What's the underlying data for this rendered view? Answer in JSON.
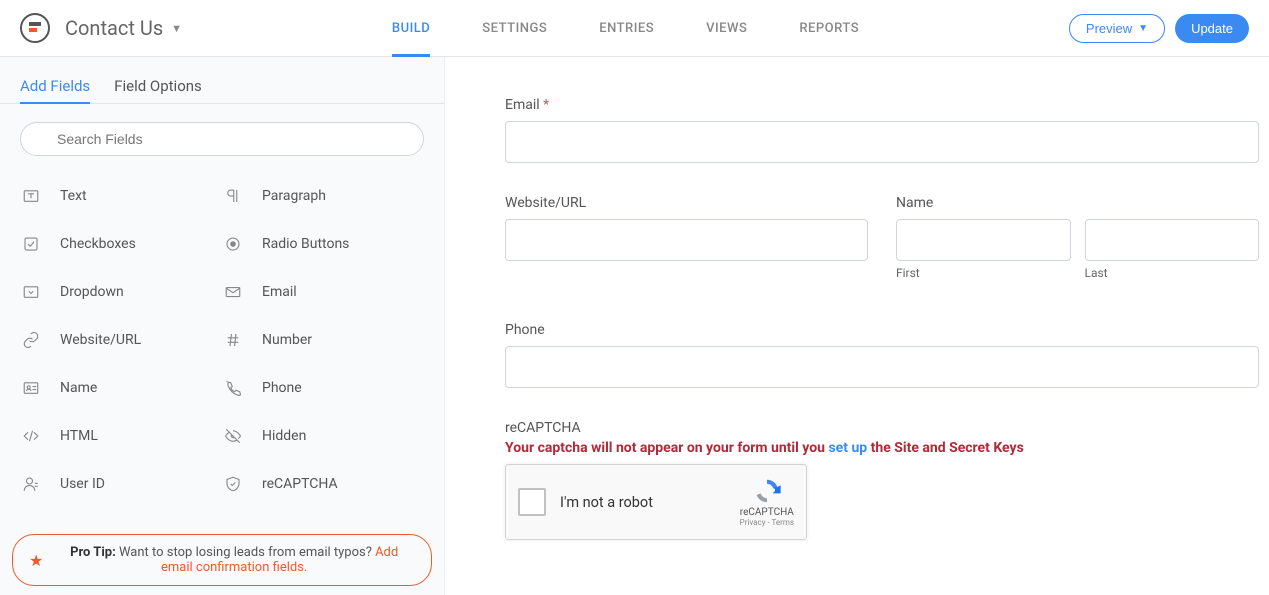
{
  "header": {
    "form_title": "Contact Us",
    "nav": [
      "BUILD",
      "SETTINGS",
      "ENTRIES",
      "VIEWS",
      "REPORTS"
    ],
    "active_nav": "BUILD",
    "preview_label": "Preview",
    "update_label": "Update"
  },
  "sidebar": {
    "tabs": [
      "Add Fields",
      "Field Options"
    ],
    "active_tab": "Add Fields",
    "search_placeholder": "Search Fields",
    "fields_left": [
      "Text",
      "Checkboxes",
      "Dropdown",
      "Website/URL",
      "Name",
      "HTML",
      "User ID"
    ],
    "fields_right": [
      "Paragraph",
      "Radio Buttons",
      "Email",
      "Number",
      "Phone",
      "Hidden",
      "reCAPTCHA"
    ],
    "protip_label": "Pro Tip:",
    "protip_text": "Want to stop losing leads from email typos?",
    "protip_link": "Add email confirmation fields."
  },
  "form": {
    "email_label": "Email",
    "website_label": "Website/URL",
    "name_label": "Name",
    "first_label": "First",
    "last_label": "Last",
    "phone_label": "Phone",
    "recaptcha_label": "reCAPTCHA",
    "captcha_warning_pre": "Your captcha will not appear on your form until you ",
    "captcha_warning_link": "set up",
    "captcha_warning_post": " the Site and Secret Keys",
    "recaptcha_text": "I'm not a robot",
    "recaptcha_brand": "reCAPTCHA",
    "recaptcha_privacy": "Privacy - Terms"
  }
}
